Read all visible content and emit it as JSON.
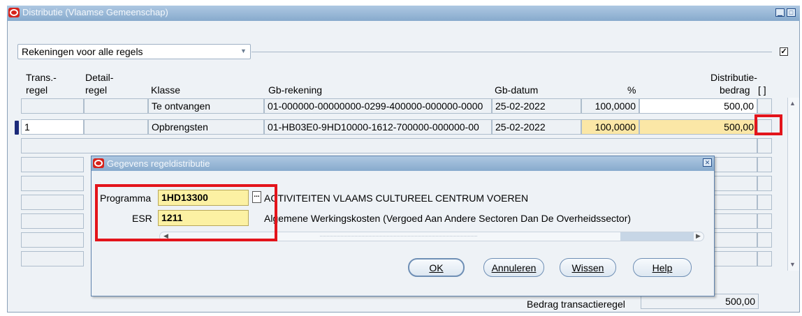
{
  "window": {
    "title": "Distributie (Vlaamse Gemeenschap)",
    "minimize_icon": "minimize-icon",
    "maximize_icon": "maximize-icon"
  },
  "dropdown": {
    "selected": "Rekeningen voor alle regels"
  },
  "checkbox_all": {
    "checked": true
  },
  "headers": {
    "trans_line1": "Trans.-",
    "trans_line2": "regel",
    "detail_line1": "Detail-",
    "detail_line2": "regel",
    "klasse": "Klasse",
    "gb_rekening": "Gb-rekening",
    "gb_datum": "Gb-datum",
    "percent": "%",
    "distributie_line1": "Distributie-",
    "distributie_line2": "bedrag",
    "flag": "[ ]"
  },
  "rows": [
    {
      "trans": "",
      "detail": "",
      "klasse": "Te ontvangen",
      "gb_rekening": "01-000000-00000000-0299-400000-000000-0000",
      "gb_datum": "25-02-2022",
      "percent": "100,0000",
      "bedrag": "500,00"
    },
    {
      "trans": "1",
      "detail": "",
      "klasse": "Opbrengsten",
      "gb_rekening": "01-HB03E0-9HD10000-1612-700000-000000-00",
      "gb_datum": "25-02-2022",
      "percent": "100,0000",
      "bedrag": "500,00"
    }
  ],
  "footer": {
    "total_label": "Bedrag transactieregel",
    "total_value": "500,00"
  },
  "dialog": {
    "title": "Gegevens regeldistributie",
    "programma_label": "Programma",
    "programma_value": "1HD13300",
    "programma_desc": "ACTIVITEITEN VLAAMS CULTUREEL CENTRUM VOEREN",
    "lov_button": "...",
    "esr_label": "ESR",
    "esr_value": "1211",
    "esr_desc": "Algemene Werkingskosten (Vergoed Aan Andere Sectoren Dan De Overheidssector)",
    "buttons": {
      "ok": "OK",
      "annuleren": "Annuleren",
      "wissen": "Wissen",
      "help": "Help"
    }
  },
  "colors": {
    "highlight": "#e3141b",
    "selected_field": "#fbe7a6",
    "titlebar": "#87aacd"
  }
}
